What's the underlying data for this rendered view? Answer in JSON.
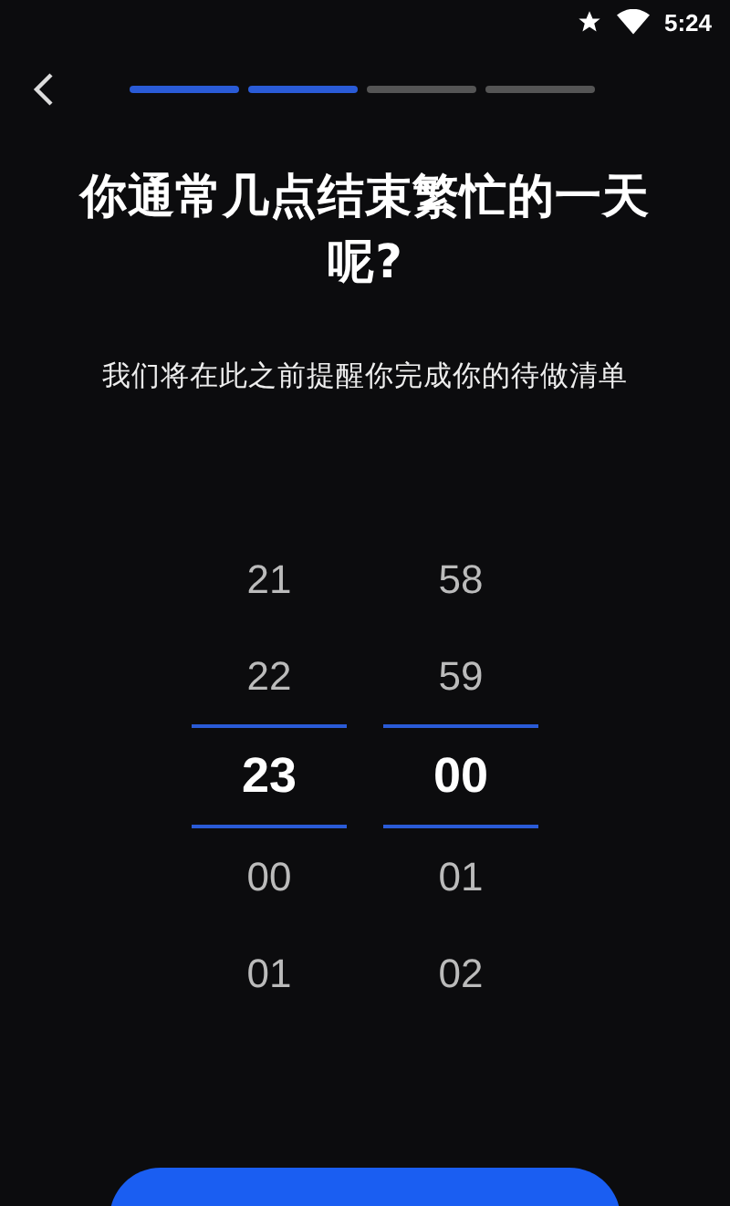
{
  "status_bar": {
    "time": "5:24"
  },
  "progress": [
    {
      "completed": true
    },
    {
      "completed": true
    },
    {
      "completed": false
    },
    {
      "completed": false
    }
  ],
  "title": "你通常几点结束繁忙的一天呢?",
  "subtitle": "我们将在此之前提醒你完成你的待做清单",
  "pickers": [
    {
      "values": [
        {
          "label": "21",
          "selected": false
        },
        {
          "label": "22",
          "selected": false
        },
        {
          "label": "23",
          "selected": true
        },
        {
          "label": "00",
          "selected": false
        },
        {
          "label": "01",
          "selected": false
        }
      ]
    },
    {
      "values": [
        {
          "label": "58",
          "selected": false
        },
        {
          "label": "59",
          "selected": false
        },
        {
          "label": "00",
          "selected": true
        },
        {
          "label": "01",
          "selected": false
        },
        {
          "label": "02",
          "selected": false
        }
      ]
    }
  ],
  "continue_button": {
    "kind": "primary"
  }
}
